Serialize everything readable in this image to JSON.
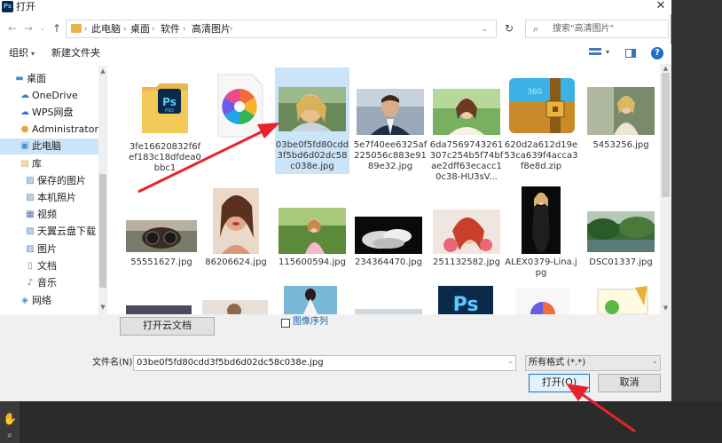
{
  "app": {
    "badge": "Ps",
    "title": "打开"
  },
  "window": {
    "close_glyph": "✕"
  },
  "nav": {
    "back_glyph": "←",
    "forward_glyph": "→",
    "up_glyph": "↑",
    "refresh_glyph": "↻",
    "breadcrumb": [
      "此电脑",
      "桌面",
      "软件",
      "高清图片"
    ],
    "search_placeholder": "搜索\"高清图片\""
  },
  "toolbar": {
    "organize": "组织",
    "new_folder": "新建文件夹",
    "help": "?"
  },
  "sidebar": {
    "items": [
      {
        "label": "桌面",
        "icon": "desktop-icon",
        "color": "#3c8fd6"
      },
      {
        "label": "OneDrive",
        "icon": "cloud-icon",
        "color": "#2a7fd4"
      },
      {
        "label": "WPS网盘",
        "icon": "cloud-icon",
        "color": "#3a6fd8"
      },
      {
        "label": "Administrator",
        "icon": "user-icon",
        "color": "#e0a640"
      },
      {
        "label": "此电脑",
        "icon": "computer-icon",
        "color": "#4a8fd0"
      },
      {
        "label": "库",
        "icon": "library-icon",
        "color": "#e0a640"
      },
      {
        "label": "保存的图片",
        "icon": "picture-icon",
        "color": "#5a8fc8"
      },
      {
        "label": "本机照片",
        "icon": "picture-icon",
        "color": "#5a8fc8"
      },
      {
        "label": "视频",
        "icon": "video-icon",
        "color": "#5a6fb8"
      },
      {
        "label": "天翼云盘下载",
        "icon": "download-icon",
        "color": "#5a8fc8"
      },
      {
        "label": "图片",
        "icon": "picture-icon",
        "color": "#5a8fc8"
      },
      {
        "label": "文档",
        "icon": "document-icon",
        "color": "#7a8fa8"
      },
      {
        "label": "音乐",
        "icon": "music-icon",
        "color": "#4a7fc0"
      },
      {
        "label": "网络",
        "icon": "network-icon",
        "color": "#4a8fd0"
      }
    ]
  },
  "files": [
    {
      "name": "3fe16620832f6fef183c18dfdea0bbc1",
      "icon": "psd-folder-icon"
    },
    {
      "name": "",
      "icon": "photos-app-icon"
    },
    {
      "name": "03be0f5fd80cdd3f5bd6d02dc58c038e.jpg",
      "icon": "image-thumbnail"
    },
    {
      "name": "5e7f40ee6325af225056c883e9189e32.jpg",
      "icon": "image-thumbnail"
    },
    {
      "name": "6da7569743261307c254b5f74bfae2dff63ecacc10c38-HU3sV...",
      "icon": "image-thumbnail"
    },
    {
      "name": "620d2a612d19e53ca639f4acca3f8e8d.zip",
      "icon": "zip-icon"
    },
    {
      "name": "5453256.jpg",
      "icon": "image-thumbnail"
    },
    {
      "name": "55551627.jpg",
      "icon": "image-thumbnail"
    },
    {
      "name": "86206624.jpg",
      "icon": "image-thumbnail"
    },
    {
      "name": "115600594.jpg",
      "icon": "image-thumbnail"
    },
    {
      "name": "234364470.jpg",
      "icon": "image-thumbnail"
    },
    {
      "name": "251132582.jpg",
      "icon": "image-thumbnail"
    },
    {
      "name": "ALEX0379-Lina.jpg",
      "icon": "image-thumbnail"
    },
    {
      "name": "DSC01337.jpg",
      "icon": "image-thumbnail"
    }
  ],
  "bottom": {
    "open_cloud": "打开云文档",
    "image_sequence": "图像序列",
    "filename_label": "文件名(N):",
    "filename_value": "03be0f5fd80cdd3f5bd6d02dc58c038e.jpg",
    "filetype_value": "所有格式 (*.*)",
    "open_button": "打开(O)",
    "cancel_button": "取消"
  },
  "colors": {
    "selection": "#cce4f7",
    "accent": "#0078d7",
    "arrow": "#e8222a"
  }
}
